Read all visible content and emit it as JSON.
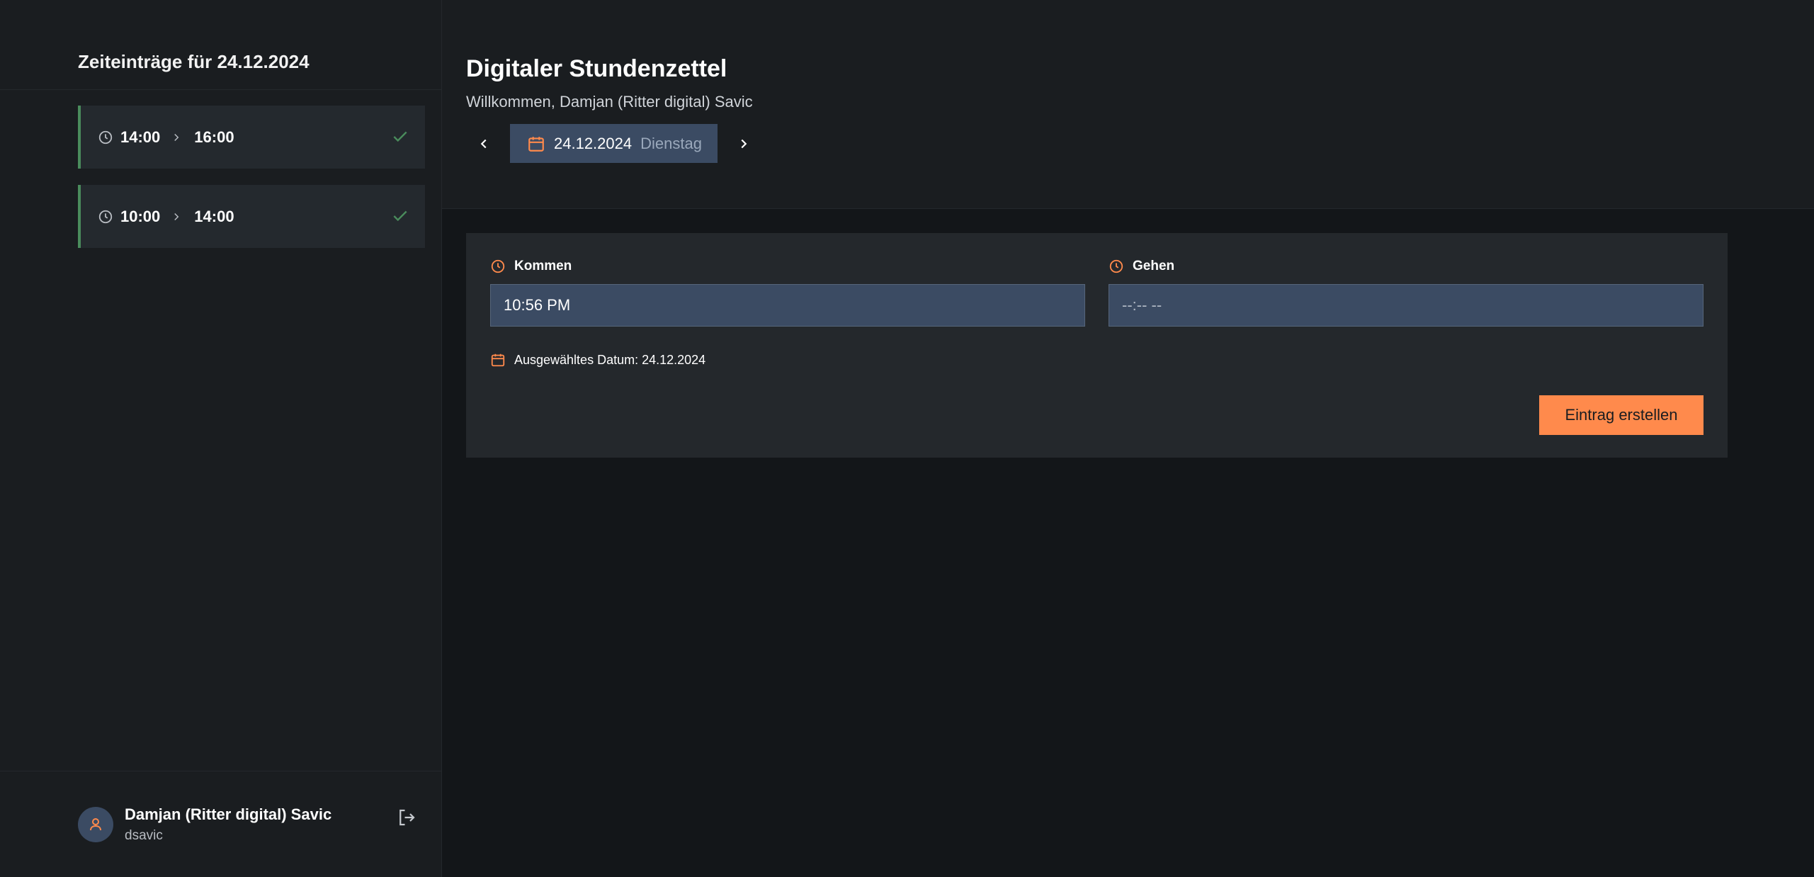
{
  "sidebar": {
    "title": "Zeiteinträge für 24.12.2024",
    "entries": [
      {
        "start": "14:00",
        "end": "16:00",
        "status": "confirmed"
      },
      {
        "start": "10:00",
        "end": "14:00",
        "status": "confirmed"
      }
    ],
    "user": {
      "name": "Damjan (Ritter digital) Savic",
      "login": "dsavic"
    }
  },
  "header": {
    "title": "Digitaler Stundenzettel",
    "welcome": "Willkommen, Damjan (Ritter digital) Savic",
    "date": "24.12.2024",
    "weekday": "Dienstag"
  },
  "form": {
    "kommen_label": "Kommen",
    "kommen_value": "10:56 PM",
    "gehen_label": "Gehen",
    "gehen_value": "--:-- --",
    "selected_date": "Ausgewähltes Datum: 24.12.2024",
    "submit_label": "Eintrag erstellen"
  },
  "colors": {
    "accent": "#ff8a4c",
    "success": "#4a8c5c",
    "input_bg": "#3b4b63"
  },
  "icons": {
    "clock": "clock-icon",
    "calendar": "calendar-icon",
    "check": "check-icon",
    "logout": "logout-icon",
    "user": "user-icon"
  }
}
